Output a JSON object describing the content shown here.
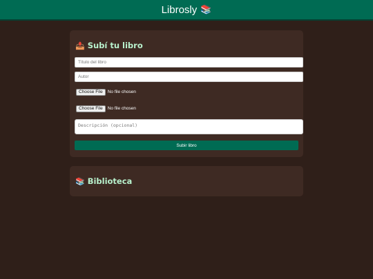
{
  "header": {
    "title": "Librosly",
    "icon": "📚"
  },
  "upload": {
    "icon": "📤",
    "heading": "Subí tu libro",
    "title_placeholder": "Título del libro",
    "author_placeholder": "Autor",
    "file1": {
      "button": "Choose File",
      "status": "No file chosen"
    },
    "file2": {
      "button": "Choose File",
      "status": "No file chosen"
    },
    "description_placeholder": "Descripción (opcional)",
    "submit_label": "Subir libro"
  },
  "library": {
    "icon": "📚",
    "heading": "Biblioteca"
  },
  "colors": {
    "accent": "#006b53",
    "background": "#2f1f19",
    "card": "#3e2a23",
    "heading": "#b8f1cd"
  }
}
